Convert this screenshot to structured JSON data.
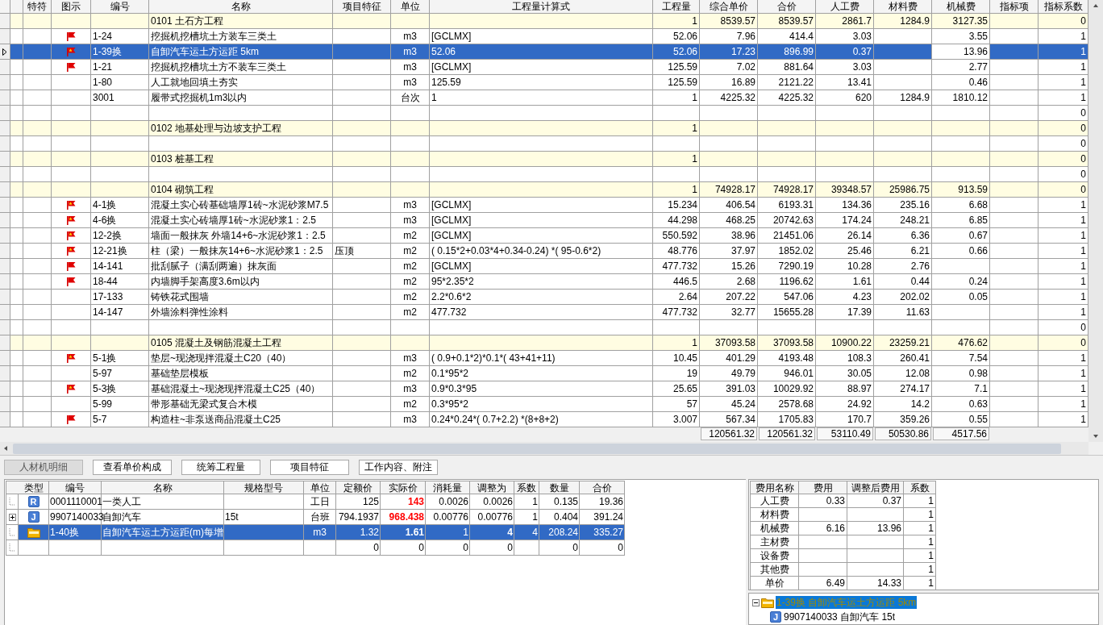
{
  "estimate_table": {
    "columns": [
      "特符",
      "图示",
      "编号",
      "名称",
      "项目特征",
      "单位",
      "工程量计算式",
      "工程量",
      "综合单价",
      "合价",
      "人工费",
      "材料费",
      "机械费",
      "指标项",
      "指标系数"
    ],
    "rows": [
      {
        "kind": "section",
        "selected": false,
        "cells": [
          "",
          "",
          "",
          "0101 土石方工程",
          "",
          "",
          "",
          "1",
          "8539.57",
          "8539.57",
          "2861.7",
          "1284.9",
          "3127.35",
          "",
          "0"
        ]
      },
      {
        "kind": "item",
        "selected": false,
        "cells": [
          "",
          {
            "kind": "flag"
          },
          "1-24",
          "挖掘机挖槽坑土方装车三类土",
          "",
          "m3",
          "[GCLMX]",
          "52.06",
          "7.96",
          "414.4",
          "3.03",
          "",
          "3.55",
          "",
          "1"
        ]
      },
      {
        "kind": "item",
        "selected": true,
        "cells": [
          "",
          {
            "kind": "starred-flag"
          },
          "1-39换",
          "自卸汽车运土方运距 5km",
          "",
          "m3",
          "52.06",
          "52.06",
          "17.23",
          "896.99",
          "0.37",
          "",
          {
            "text": "13.96",
            "focused": true
          },
          "",
          "1"
        ]
      },
      {
        "kind": "item",
        "selected": false,
        "cells": [
          "",
          {
            "kind": "flag"
          },
          "1-21",
          "挖掘机挖槽坑土方不装车三类土",
          "",
          "m3",
          "[GCLMX]",
          "125.59",
          "7.02",
          "881.64",
          "3.03",
          "",
          "2.77",
          "",
          "1"
        ]
      },
      {
        "kind": "item",
        "selected": false,
        "cells": [
          "",
          "",
          "1-80",
          "人工就地回填土夯实",
          "",
          "m3",
          "125.59",
          "125.59",
          "16.89",
          "2121.22",
          "13.41",
          "",
          "0.46",
          "",
          "1"
        ]
      },
      {
        "kind": "item",
        "selected": false,
        "cells": [
          "",
          "",
          "3001",
          "履带式挖掘机1m3以内",
          "",
          "台次",
          "1",
          "1",
          "4225.32",
          "4225.32",
          "620",
          "1284.9",
          "1810.12",
          "",
          "1"
        ]
      },
      {
        "kind": "blank",
        "selected": false,
        "cells": [
          "",
          "",
          "",
          "",
          "",
          "",
          "",
          "",
          "",
          "",
          "",
          "",
          "",
          "",
          "0"
        ]
      },
      {
        "kind": "section",
        "selected": false,
        "cells": [
          "",
          "",
          "",
          "0102 地基处理与边坡支护工程",
          "",
          "",
          "",
          "1",
          "",
          "",
          "",
          "",
          "",
          "",
          "0"
        ]
      },
      {
        "kind": "blank",
        "selected": false,
        "cells": [
          "",
          "",
          "",
          "",
          "",
          "",
          "",
          "",
          "",
          "",
          "",
          "",
          "",
          "",
          "0"
        ]
      },
      {
        "kind": "section",
        "selected": false,
        "cells": [
          "",
          "",
          "",
          "0103 桩基工程",
          "",
          "",
          "",
          "1",
          "",
          "",
          "",
          "",
          "",
          "",
          "0"
        ]
      },
      {
        "kind": "blank",
        "selected": false,
        "cells": [
          "",
          "",
          "",
          "",
          "",
          "",
          "",
          "",
          "",
          "",
          "",
          "",
          "",
          "",
          "0"
        ]
      },
      {
        "kind": "section",
        "selected": false,
        "cells": [
          "",
          "",
          "",
          "0104 砌筑工程",
          "",
          "",
          "",
          "1",
          "74928.17",
          "74928.17",
          "39348.57",
          "25986.75",
          "913.59",
          "",
          "0"
        ]
      },
      {
        "kind": "item",
        "selected": false,
        "cells": [
          "",
          {
            "kind": "starred-flag"
          },
          "4-1换",
          "混凝土实心砖基础墙厚1砖~水泥砂浆M7.5",
          "",
          "m3",
          "[GCLMX]",
          "15.234",
          "406.54",
          "6193.31",
          "134.36",
          "235.16",
          "6.68",
          "",
          "1"
        ]
      },
      {
        "kind": "item",
        "selected": false,
        "cells": [
          "",
          {
            "kind": "starred-flag"
          },
          "4-6换",
          "混凝土实心砖墙厚1砖~水泥砂浆1：2.5",
          "",
          "m3",
          "[GCLMX]",
          "44.298",
          "468.25",
          "20742.63",
          "174.24",
          "248.21",
          "6.85",
          "",
          "1"
        ]
      },
      {
        "kind": "item",
        "selected": false,
        "cells": [
          "",
          {
            "kind": "starred-flag"
          },
          "12-2换",
          "墙面一般抹灰 外墙14+6~水泥砂浆1：2.5",
          "",
          "m2",
          "[GCLMX]",
          "550.592",
          "38.96",
          "21451.06",
          "26.14",
          "6.36",
          "0.67",
          "",
          "1"
        ]
      },
      {
        "kind": "item",
        "selected": false,
        "cells": [
          "",
          {
            "kind": "starred-flag"
          },
          "12-21换",
          "柱（梁）一般抹灰14+6~水泥砂浆1：2.5",
          "压顶",
          "m2",
          "( 0.15*2+0.03*4+0.34-0.24) *( 95-0.6*2)",
          "48.776",
          "37.97",
          "1852.02",
          "25.46",
          "6.21",
          "0.66",
          "",
          "1"
        ]
      },
      {
        "kind": "item",
        "selected": false,
        "cells": [
          "",
          {
            "kind": "flag"
          },
          "14-141",
          "批刮腻子（满刮两遍）抹灰面",
          "",
          "m2",
          "[GCLMX]",
          "477.732",
          "15.26",
          "7290.19",
          "10.28",
          "2.76",
          "",
          "",
          "1"
        ]
      },
      {
        "kind": "item",
        "selected": false,
        "cells": [
          "",
          {
            "kind": "flag"
          },
          "18-44",
          "内墙脚手架高度3.6m以内",
          "",
          "m2",
          "95*2.35*2",
          "446.5",
          "2.68",
          "1196.62",
          "1.61",
          "0.44",
          "0.24",
          "",
          "1"
        ]
      },
      {
        "kind": "item",
        "selected": false,
        "cells": [
          "",
          "",
          "17-133",
          "铸铁花式围墙",
          "",
          "m2",
          "2.2*0.6*2",
          "2.64",
          "207.22",
          "547.06",
          "4.23",
          "202.02",
          "0.05",
          "",
          "1"
        ]
      },
      {
        "kind": "item",
        "selected": false,
        "cells": [
          "",
          "",
          "14-147",
          "外墙涂料弹性涂料",
          "",
          "m2",
          "477.732",
          "477.732",
          "32.77",
          "15655.28",
          "17.39",
          "11.63",
          "",
          "",
          "1"
        ]
      },
      {
        "kind": "blank",
        "selected": false,
        "cells": [
          "",
          "",
          "",
          "",
          "",
          "",
          "",
          "",
          "",
          "",
          "",
          "",
          "",
          "",
          "0"
        ]
      },
      {
        "kind": "section",
        "selected": false,
        "cells": [
          "",
          "",
          "",
          "0105 混凝土及钢筋混凝土工程",
          "",
          "",
          "",
          "1",
          "37093.58",
          "37093.58",
          "10900.22",
          "23259.21",
          "476.62",
          "",
          "0"
        ]
      },
      {
        "kind": "item",
        "selected": false,
        "cells": [
          "",
          {
            "kind": "starred-flag"
          },
          "5-1换",
          "垫层~现浇现拌混凝土C20（40）",
          "",
          "m3",
          "( 0.9+0.1*2)*0.1*( 43+41+11)",
          "10.45",
          "401.29",
          "4193.48",
          "108.3",
          "260.41",
          "7.54",
          "",
          "1"
        ]
      },
      {
        "kind": "item",
        "selected": false,
        "cells": [
          "",
          "",
          "5-97",
          "基础垫层模板",
          "",
          "m2",
          "0.1*95*2",
          "19",
          "49.79",
          "946.01",
          "30.05",
          "12.08",
          "0.98",
          "",
          "1"
        ]
      },
      {
        "kind": "item",
        "selected": false,
        "cells": [
          "",
          {
            "kind": "starred-flag"
          },
          "5-3换",
          "基础混凝土~现浇现拌混凝土C25（40）",
          "",
          "m3",
          "0.9*0.3*95",
          "25.65",
          "391.03",
          "10029.92",
          "88.97",
          "274.17",
          "7.1",
          "",
          "1"
        ]
      },
      {
        "kind": "item",
        "selected": false,
        "cells": [
          "",
          "",
          "5-99",
          "带形基础无梁式复合木模",
          "",
          "m2",
          "0.3*95*2",
          "57",
          "45.24",
          "2578.68",
          "24.92",
          "14.2",
          "0.63",
          "",
          "1"
        ]
      },
      {
        "kind": "item",
        "selected": false,
        "cells": [
          "",
          {
            "kind": "flag"
          },
          "5-7",
          "构造柱~非泵送商品混凝土C25",
          "",
          "m3",
          "0.24*0.24*( 0.7+2.2) *(8+8+2)",
          "3.007",
          "567.34",
          "1705.83",
          "170.7",
          "359.26",
          "0.55",
          "",
          "1"
        ]
      }
    ],
    "totals": [
      "120561.32",
      "120561.32",
      "53110.49",
      "50530.86",
      "4517.56"
    ]
  },
  "detail_tabs": [
    {
      "label": "人材机明细",
      "selected": true
    },
    {
      "label": "查看单价构成",
      "selected": false
    },
    {
      "label": "统筹工程量",
      "selected": false
    },
    {
      "label": "项目特征",
      "selected": false
    },
    {
      "label": "工作内容、附注",
      "selected": false
    }
  ],
  "resource_table": {
    "columns": [
      "类型",
      "编号",
      "名称",
      "规格型号",
      "单位",
      "定额价",
      "实际价",
      "消耗量",
      "调整为",
      "系数",
      "数量",
      "合价"
    ],
    "rows": [
      {
        "expandable": false,
        "selected": false,
        "cells": [
          {
            "kind": "badge",
            "text": "R"
          },
          "0001110001",
          "一类人工",
          "",
          "工日",
          "125",
          {
            "text": "143",
            "changed": true
          },
          "0.0026",
          "0.0026",
          "1",
          "0.135",
          "19.36"
        ]
      },
      {
        "expandable": true,
        "selected": false,
        "cells": [
          {
            "kind": "badge",
            "text": "J"
          },
          "9907140033",
          "自卸汽车",
          "15t",
          "台班",
          "794.1937",
          {
            "text": "968.438",
            "changed": true
          },
          "0.00776",
          "0.00776",
          "1",
          "0.404",
          "391.24"
        ]
      },
      {
        "expandable": false,
        "selected": true,
        "cells": [
          {
            "kind": "folder"
          },
          "1-40换",
          "自卸汽车运土方运距(m)每增",
          "",
          "m3",
          "1.32",
          {
            "text": "1.61",
            "changed": true
          },
          "1",
          {
            "text": "4",
            "changed": true
          },
          "4",
          "208.24",
          "335.27"
        ]
      },
      {
        "expandable": false,
        "selected": false,
        "cells": [
          "",
          "",
          "",
          "",
          "",
          "0",
          "0",
          "0",
          "0",
          "",
          "0",
          "0"
        ]
      }
    ]
  },
  "fee_table": {
    "columns": [
      "费用名称",
      "费用",
      "调整后费用",
      "系数"
    ],
    "rows": [
      [
        "人工费",
        "0.33",
        "0.37",
        "1"
      ],
      [
        "材料费",
        "",
        "",
        "1"
      ],
      [
        "机械费",
        "6.16",
        "13.96",
        "1"
      ],
      [
        "主材费",
        "",
        "",
        "1"
      ],
      [
        "设备费",
        "",
        "",
        "1"
      ],
      [
        "其他费",
        "",
        "",
        "1"
      ],
      [
        "单价",
        "6.49",
        "14.33",
        "1"
      ]
    ]
  },
  "composition_tree": [
    {
      "text": "1-39换 自卸汽车运土方运距 5km",
      "icon": {
        "kind": "folder"
      },
      "selected": true,
      "expanded": true,
      "children": [
        {
          "text": "9907140033 自卸汽车 15t",
          "icon": {
            "kind": "badge",
            "text": "J"
          },
          "selected": false
        }
      ]
    }
  ]
}
